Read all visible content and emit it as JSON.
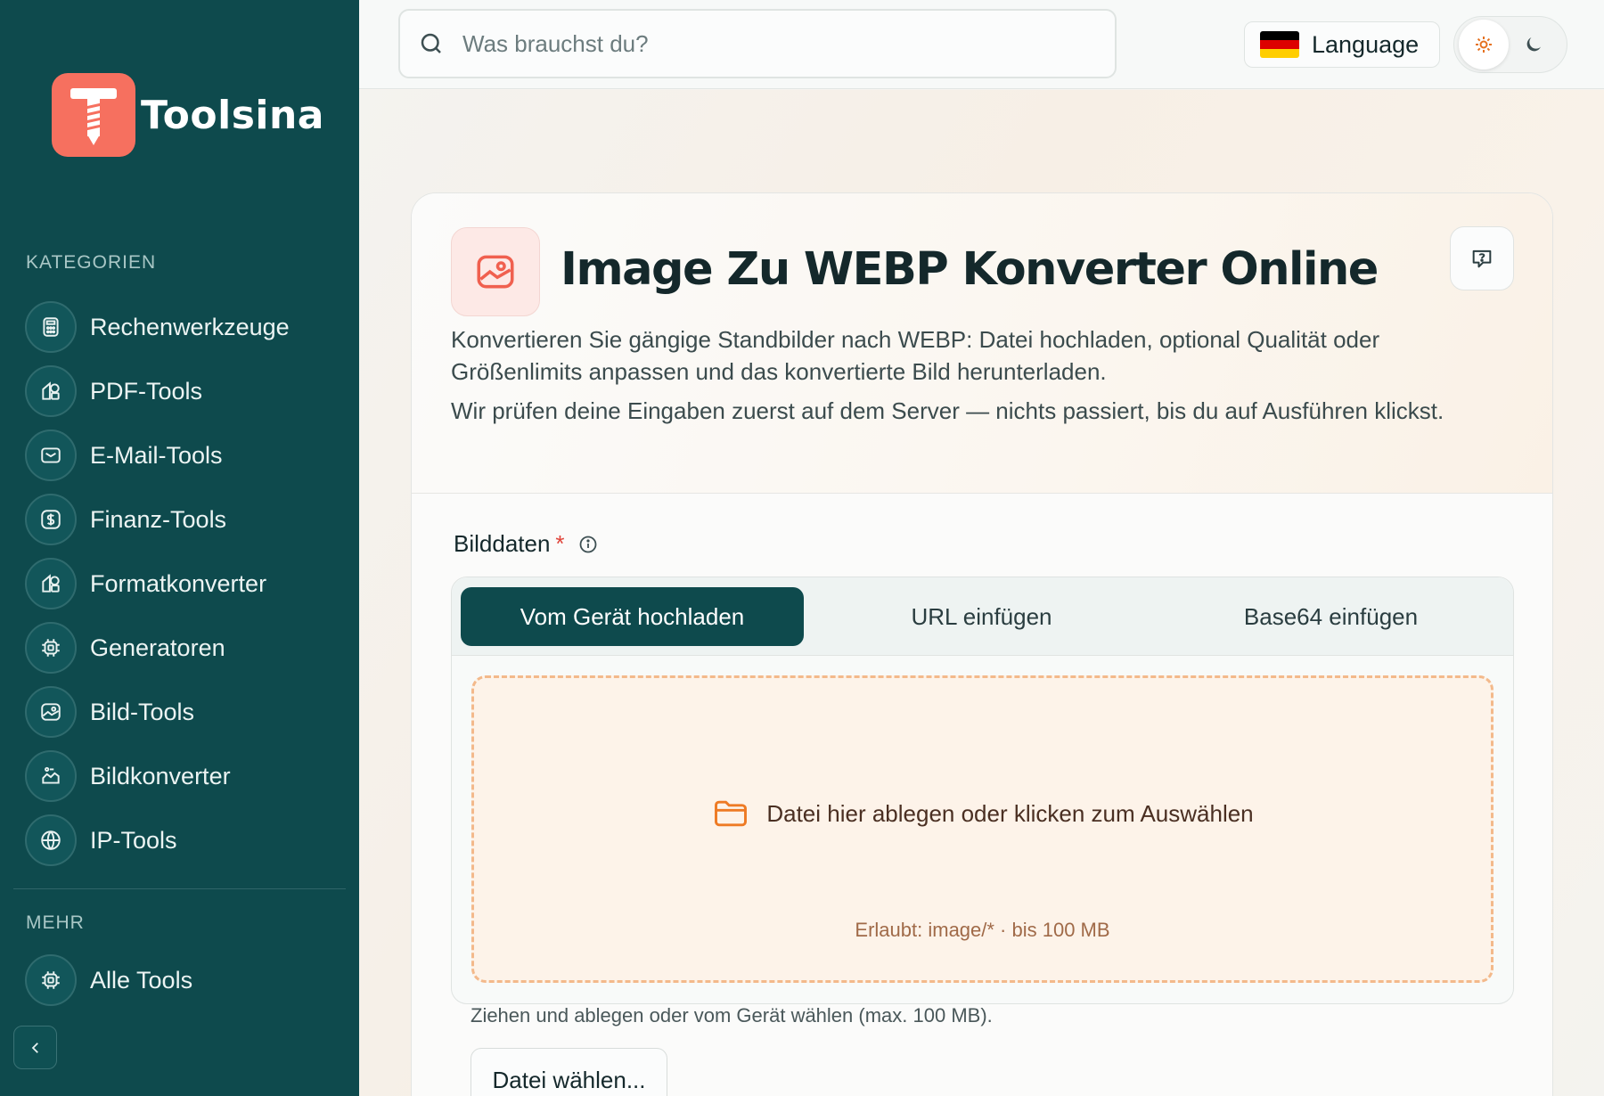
{
  "brand": {
    "name": "Toolsina"
  },
  "sidebar": {
    "categories_label": "KATEGORIEN",
    "items": [
      {
        "label": "Rechenwerkzeuge",
        "icon": "calculator-icon"
      },
      {
        "label": "PDF-Tools",
        "icon": "shapes-icon"
      },
      {
        "label": "E-Mail-Tools",
        "icon": "mail-icon"
      },
      {
        "label": "Finanz-Tools",
        "icon": "dollar-icon"
      },
      {
        "label": "Formatkonverter",
        "icon": "shapes-icon"
      },
      {
        "label": "Generatoren",
        "icon": "cpu-icon"
      },
      {
        "label": "Bild-Tools",
        "icon": "image-icon"
      },
      {
        "label": "Bildkonverter",
        "icon": "image-convert-icon"
      },
      {
        "label": "IP-Tools",
        "icon": "globe-icon"
      }
    ],
    "more_label": "MEHR",
    "more_items": [
      {
        "label": "Alle Tools",
        "icon": "cpu-icon"
      }
    ]
  },
  "topbar": {
    "search_placeholder": "Was brauchst du?",
    "language_label": "Language"
  },
  "tool": {
    "title": "Image Zu WEBP Konverter Online",
    "description": "Konvertieren Sie gängige Standbilder nach WEBP: Datei hochladen, optional Qualität oder Größenlimits anpassen und das konvertierte Bild herunterladen.",
    "server_note": "Wir prüfen deine Eingaben zuerst auf dem Server — nichts passiert, bis du auf Ausführen klickst."
  },
  "form": {
    "field_label": "Bilddaten",
    "required_mark": "*",
    "tabs": [
      {
        "label": "Vom Gerät hochladen",
        "active": true
      },
      {
        "label": "URL einfügen",
        "active": false
      },
      {
        "label": "Base64 einfügen",
        "active": false
      }
    ],
    "dropzone_text": "Datei hier ablegen oder klicken zum Auswählen",
    "dropzone_allowed": "Erlaubt: image/* · bis 100 MB",
    "hint": "Ziehen und ablegen oder vom Gerät wählen (max. 100 MB).",
    "choose_file_label": "Datei wählen..."
  },
  "colors": {
    "sidebar_bg": "#0e4a4d",
    "accent": "#f6705f",
    "dropzone_border": "#f3b98b"
  }
}
